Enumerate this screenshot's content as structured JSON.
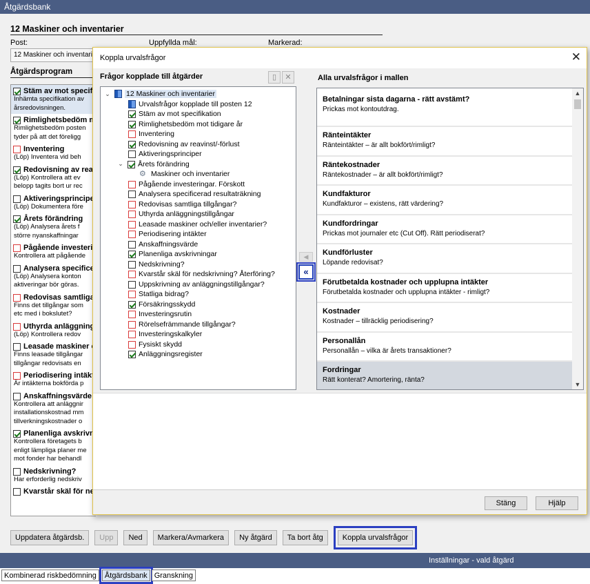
{
  "window": {
    "title": "Åtgärdsbank"
  },
  "section": {
    "title": "12 Maskiner och inventarier",
    "post_label": "Post:",
    "uppfyllda_label": "Uppfyllda mål:",
    "markerad_label": "Markerad:",
    "post_value": "12 Maskiner och inventarier",
    "program_title": "Åtgärdsprogram"
  },
  "actions": [
    {
      "title": "Stäm av mot specifikation",
      "checked": true,
      "red": false,
      "desc": "Inhämta specifikation av\nårsredovisningen."
    },
    {
      "title": "Rimlighetsbedöm mot tidigare år",
      "checked": true,
      "red": false,
      "desc": "Rimlighetsbedöm posten\ntyder på att det föreligg"
    },
    {
      "title": "Inventering",
      "checked": false,
      "red": true,
      "desc": "(Löp) Inventera vid beh"
    },
    {
      "title": "Redovisning av reavinst/-förlust",
      "checked": true,
      "red": false,
      "desc": "(Löp) Kontrollera att ev\nbelopp tagits bort ur rec"
    },
    {
      "title": "Aktiveringsprinciper",
      "checked": false,
      "red": false,
      "desc": "(Löp) Dokumentera före"
    },
    {
      "title": "Årets förändring",
      "checked": true,
      "red": false,
      "desc": "(Löp) Analysera årets f\nstörre nyanskaffningar"
    },
    {
      "title": "Pågående investeringar",
      "checked": false,
      "red": true,
      "desc": "Kontrollera att pågående"
    },
    {
      "title": "Analysera specificerad",
      "checked": false,
      "red": false,
      "desc": "(Löp) Analysera konton\naktiveringar bör göras."
    },
    {
      "title": "Redovisas samtliga tillgångar",
      "checked": false,
      "red": true,
      "desc": "Finns det tillgångar som\netc med i bokslutet?"
    },
    {
      "title": "Uthyrda anläggningstillgångar",
      "checked": false,
      "red": true,
      "desc": "(Löp) Kontrollera redov"
    },
    {
      "title": "Leasade maskiner och/eller",
      "checked": false,
      "red": false,
      "desc": "Finns leasade tillgångar\ntillgångar redovisats en"
    },
    {
      "title": "Periodisering intäkter",
      "checked": false,
      "red": true,
      "desc": "Är intäkterna bokförda p"
    },
    {
      "title": "Anskaffningsvärde",
      "checked": false,
      "red": false,
      "desc": "Kontrollera att anläggnir\ninstallationskostnad mm\ntillverkningskostnader o"
    },
    {
      "title": "Planenliga avskrivningar",
      "checked": true,
      "red": false,
      "desc": "Kontrollera företagets b\nenligt lämpliga planer me\nmot fonder har behandl"
    },
    {
      "title": "Nedskrivning?",
      "checked": false,
      "red": false,
      "desc": "Har erforderlig nedskriv"
    },
    {
      "title": "Kvarstår skäl för nedskrivning?",
      "checked": false,
      "red": false,
      "desc": ""
    }
  ],
  "bottom_buttons": {
    "update": "Uppdatera åtgärdsb.",
    "up": "Upp",
    "down": "Ned",
    "mark": "Markera/Avmarkera",
    "new": "Ny åtgärd",
    "delete": "Ta bort åtg",
    "link": "Koppla urvalsfrågor"
  },
  "status": {
    "text": "Inställningar - vald åtgärd"
  },
  "tabs": [
    {
      "label": "Kombinerad riskbedömning",
      "active": false
    },
    {
      "label": "Åtgärdsbank",
      "active": true
    },
    {
      "label": "Granskning",
      "active": false
    }
  ],
  "dialog": {
    "title": "Koppla urvalsfrågor",
    "left_heading": "Frågor kopplade till åtgärder",
    "right_heading": "Alla urvalsfrågor i mallen",
    "close_label": "Stäng",
    "help_label": "Hjälp",
    "tree": {
      "root": "12 Maskiner och inventarier",
      "items": [
        {
          "label": "Urvalsfrågor kopplade till posten 12",
          "type": "doc"
        },
        {
          "label": "Stäm av mot specifikation",
          "type": "check",
          "checked": true
        },
        {
          "label": "Rimlighetsbedöm mot tidigare år",
          "type": "check",
          "checked": true
        },
        {
          "label": "Inventering",
          "type": "check",
          "checked": false,
          "red": true
        },
        {
          "label": "Redovisning av reavinst/-förlust",
          "type": "check",
          "checked": true
        },
        {
          "label": "Aktiveringsprinciper",
          "type": "check",
          "checked": false
        },
        {
          "label": "Årets förändring",
          "type": "check",
          "checked": true,
          "expanded": true
        },
        {
          "label": "Maskiner och inventarier",
          "type": "child"
        },
        {
          "label": "Pågående investeringar. Förskott",
          "type": "check",
          "checked": false,
          "red": true
        },
        {
          "label": "Analysera specificerad resultaträkning",
          "type": "check",
          "checked": false
        },
        {
          "label": "Redovisas samtliga tillgångar?",
          "type": "check",
          "checked": false,
          "red": true
        },
        {
          "label": "Uthyrda anläggningstillgångar",
          "type": "check",
          "checked": false,
          "red": true
        },
        {
          "label": "Leasade maskiner och/eller inventarier?",
          "type": "check",
          "checked": false,
          "red": true
        },
        {
          "label": "Periodisering intäkter",
          "type": "check",
          "checked": false,
          "red": true
        },
        {
          "label": "Anskaffningsvärde",
          "type": "check",
          "checked": false
        },
        {
          "label": "Planenliga avskrivningar",
          "type": "check",
          "checked": true
        },
        {
          "label": "Nedskrivning?",
          "type": "check",
          "checked": false
        },
        {
          "label": "Kvarstår skäl för nedskrivning? Återföring?",
          "type": "check",
          "checked": false,
          "red": true
        },
        {
          "label": "Uppskrivning av anläggningstillgångar?",
          "type": "check",
          "checked": false
        },
        {
          "label": "Statliga bidrag?",
          "type": "check",
          "checked": false,
          "red": true
        },
        {
          "label": "Försäkringsskydd",
          "type": "check",
          "checked": true
        },
        {
          "label": "Investeringsrutin",
          "type": "check",
          "checked": false,
          "red": true
        },
        {
          "label": "Rörelsefrämmande tillgångar?",
          "type": "check",
          "checked": false,
          "red": true
        },
        {
          "label": "Investeringskalkyler",
          "type": "check",
          "checked": false,
          "red": true
        },
        {
          "label": "Fysiskt skydd",
          "type": "check",
          "checked": false,
          "red": true
        },
        {
          "label": "Anläggningsregister",
          "type": "check",
          "checked": true
        }
      ]
    },
    "questions": [
      {
        "title": "Betalningar sista dagarna - rätt avstämt?",
        "desc": "Prickas mot kontoutdrag.",
        "selected": false
      },
      {
        "title": "Ränteintäkter",
        "desc": "Ränteintäkter – är allt bokfört/rimligt?",
        "selected": false
      },
      {
        "title": "Räntekostnader",
        "desc": "Räntekostnader – är allt bokfört/rimligt?",
        "selected": false
      },
      {
        "title": "Kundfakturor",
        "desc": "Kundfakturor – existens, rätt värdering?",
        "selected": false
      },
      {
        "title": "Kundfordringar",
        "desc": "Prickas mot journaler etc (Cut Off). Rätt periodiserat?",
        "selected": false
      },
      {
        "title": "Kundförluster",
        "desc": "Löpande redovisat?",
        "selected": false
      },
      {
        "title": "Förutbetalda kostnader och upplupna intäkter",
        "desc": "Förutbetalda kostnader och upplupna intäkter - rimligt?",
        "selected": false
      },
      {
        "title": "Kostnader",
        "desc": "Kostnader – tillräcklig periodisering?",
        "selected": false
      },
      {
        "title": "Personallån",
        "desc": "Personallån – vilka är årets transaktioner?",
        "selected": false
      },
      {
        "title": "Fordringar",
        "desc": "Rätt konterat? Amortering, ränta?",
        "selected": true
      }
    ]
  },
  "icons": {
    "close": "close-icon",
    "new_doc": "new-document-icon",
    "delete": "delete-icon",
    "move_left": "double-chevron-left-icon",
    "gear": "gear-icon",
    "document": "document-icon"
  }
}
